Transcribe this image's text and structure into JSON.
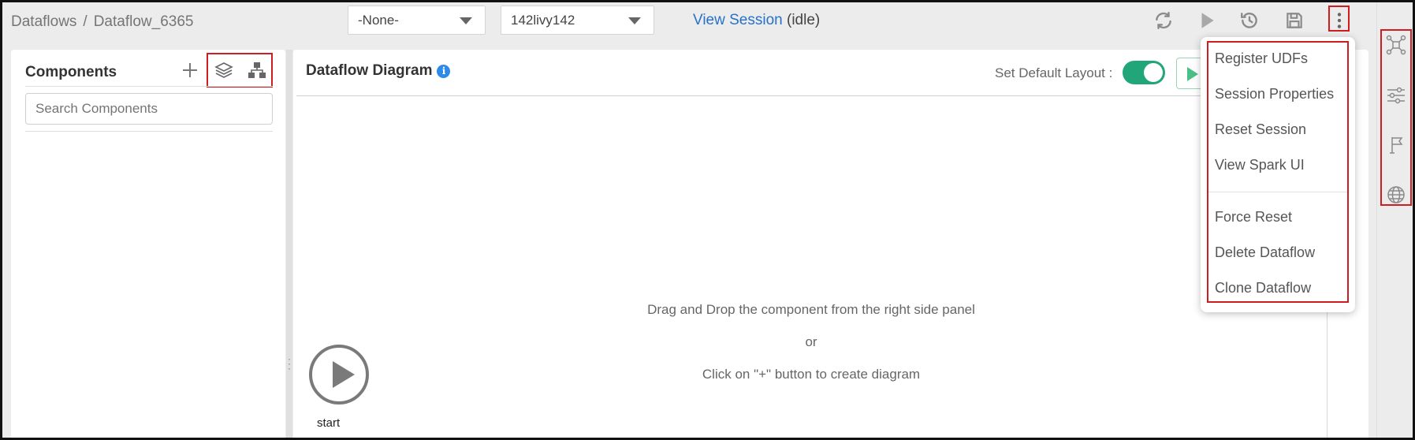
{
  "breadcrumb": {
    "root": "Dataflows",
    "separator": "/",
    "current": "Dataflow_6365"
  },
  "toolbar": {
    "select_1": "-None-",
    "select_2": "142livy142",
    "session_link": "View Session",
    "session_state": "(idle)"
  },
  "components_panel": {
    "title": "Components",
    "search_placeholder": "Search Components"
  },
  "diagram": {
    "title": "Dataflow Diagram",
    "info_glyph": "i",
    "layout_label": "Set Default Layout :",
    "layout_toggle_on": true,
    "hint_line_1": "Drag and Drop the component from the right side panel",
    "hint_or": "or",
    "hint_line_2": "Click on \"+\" button to create diagram",
    "start_label": "start"
  },
  "menu": {
    "items": [
      "Register UDFs",
      "Session Properties",
      "Reset Session",
      "View Spark UI",
      "Force Reset",
      "Delete Dataflow",
      "Clone Dataflow"
    ]
  },
  "colors": {
    "accent": "#2672c8",
    "toggle": "#21a67a",
    "highlight": "#d01c20",
    "info": "#2e8ae6"
  },
  "icons": [
    "refresh-icon",
    "play-icon",
    "history-icon",
    "save-icon",
    "kebab-menu-icon",
    "plus-icon",
    "layers-icon",
    "hierarchy-icon",
    "components-rail-icon",
    "settings-rail-icon",
    "flag-rail-icon",
    "globe-rail-icon"
  ]
}
